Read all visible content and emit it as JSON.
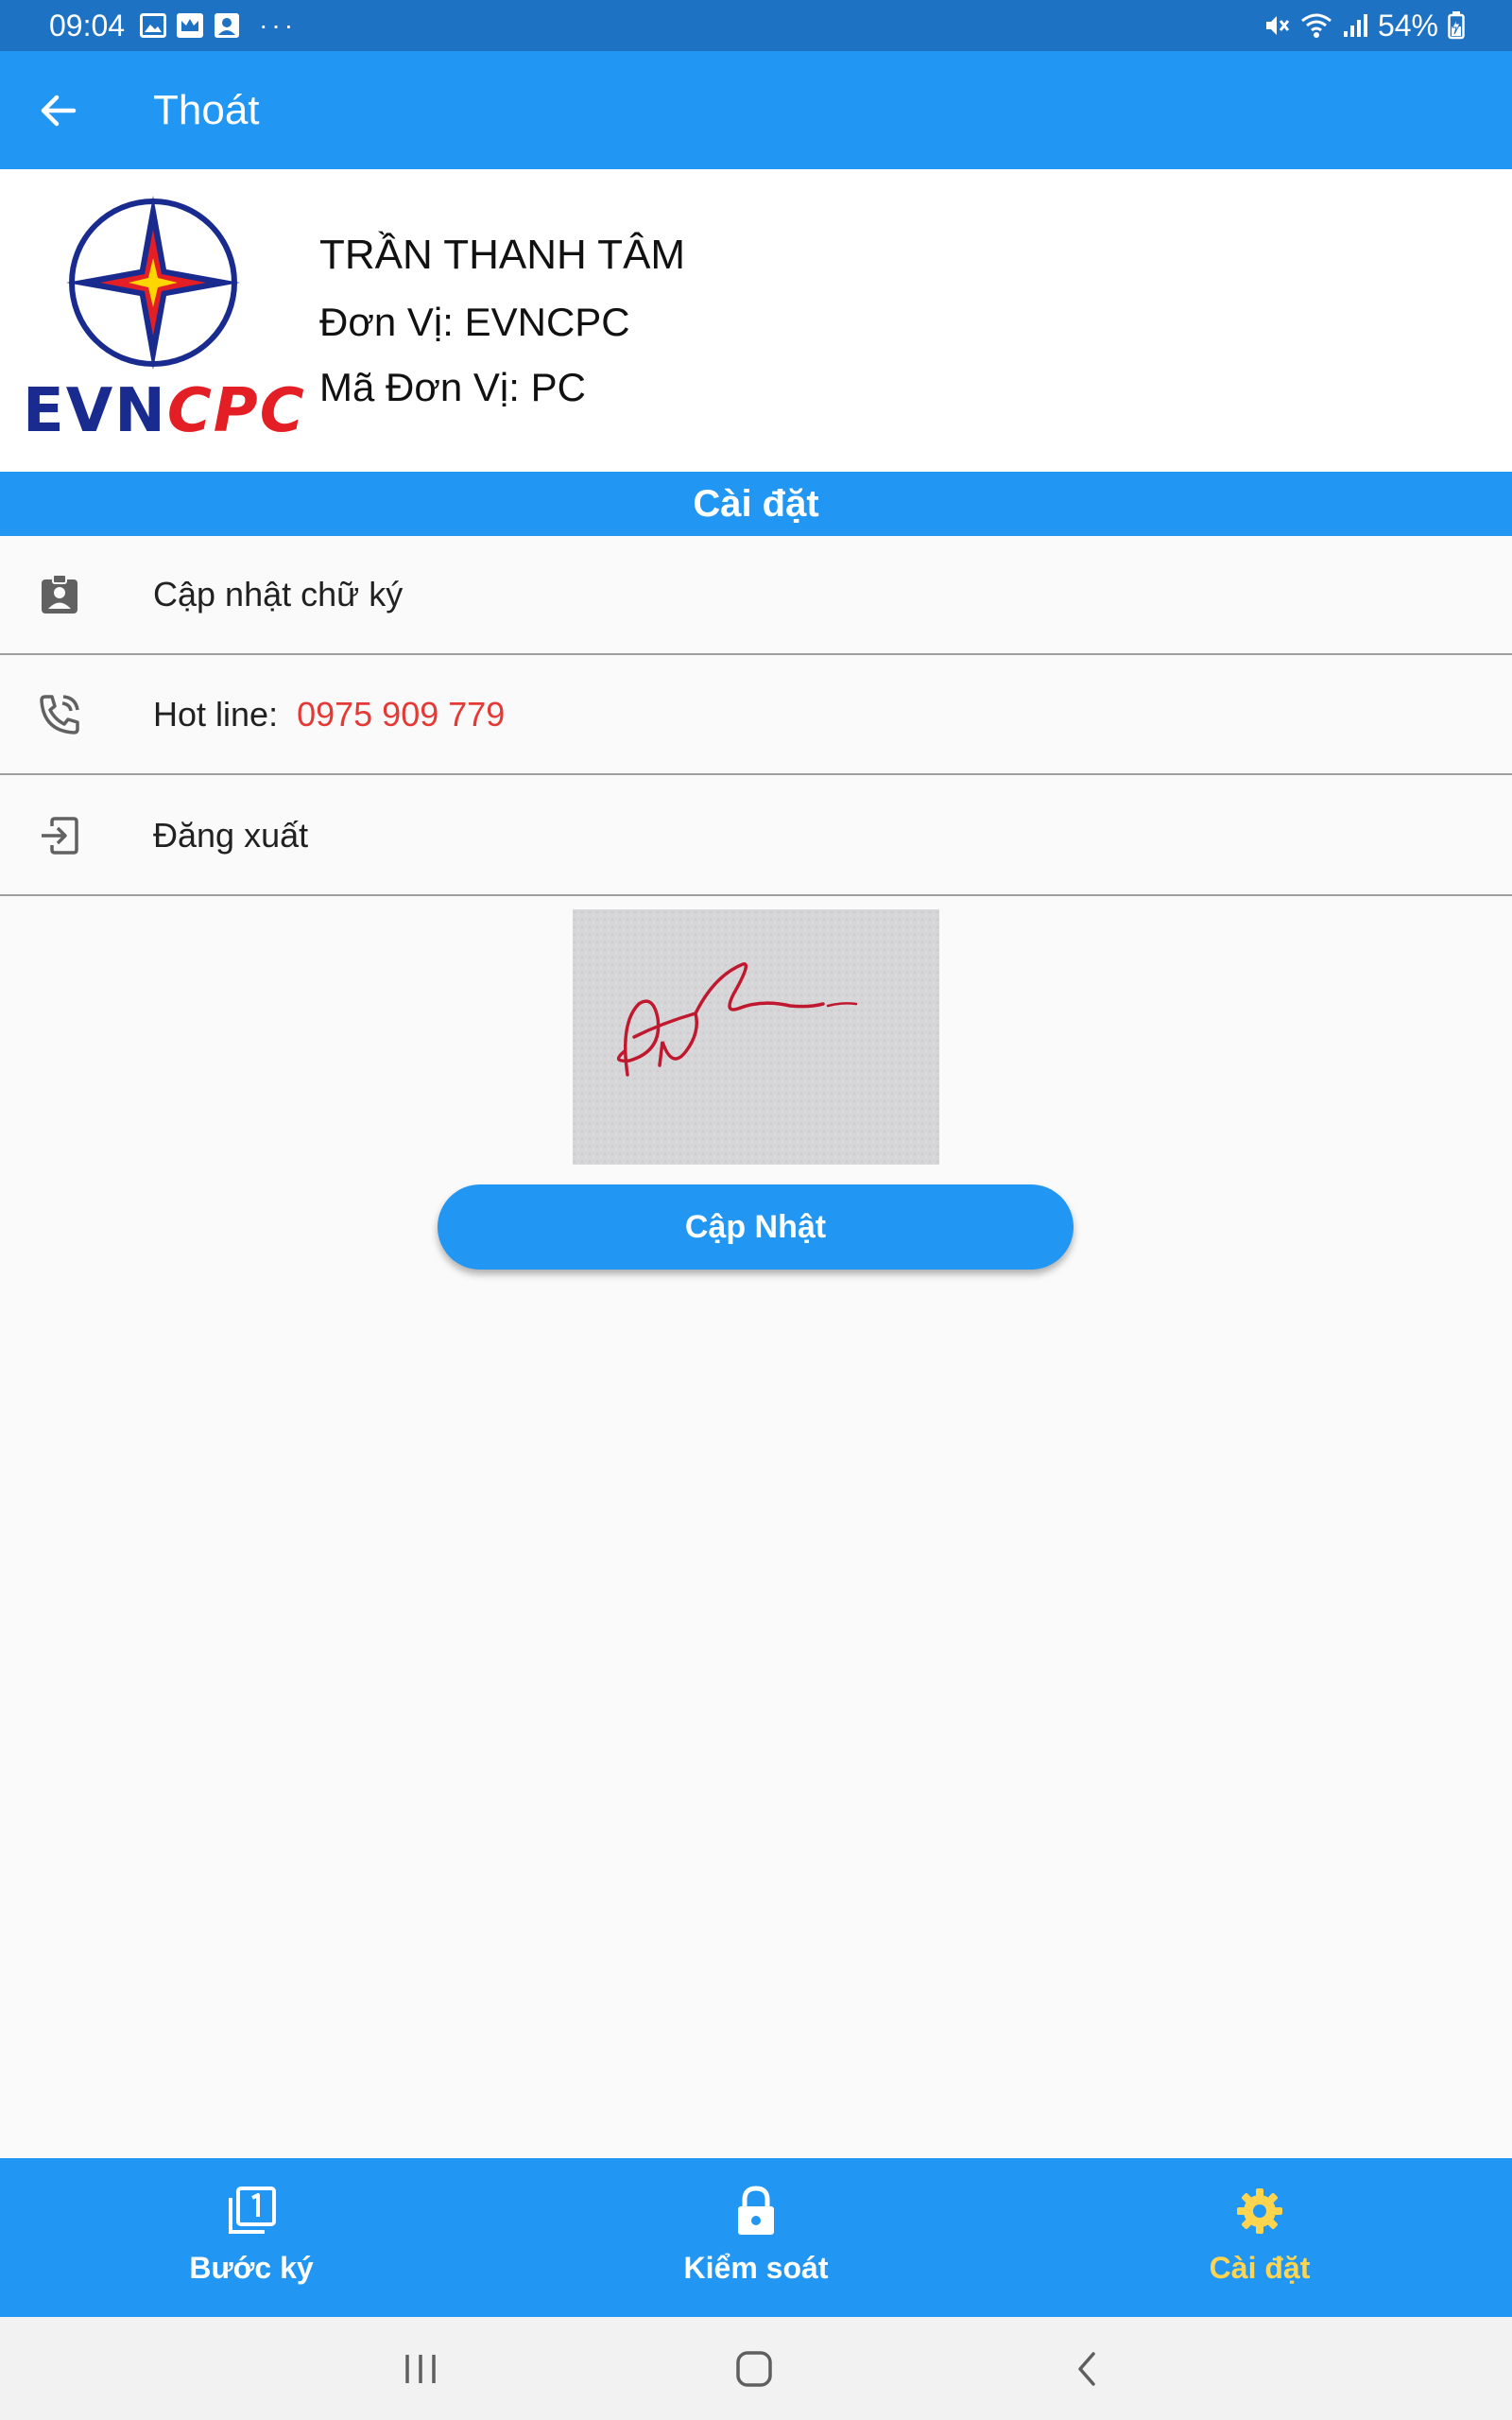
{
  "status_bar": {
    "time": "09:04",
    "battery": "54%",
    "icons": [
      "image-icon",
      "crown-icon",
      "contact-icon",
      "more-dots-icon",
      "mute-icon",
      "wifi-icon",
      "signal-icon",
      "battery-charging-icon"
    ]
  },
  "app_bar": {
    "title": "Thoát",
    "back_icon": "arrow-left-icon"
  },
  "profile": {
    "logo_text_evn": "EVN",
    "logo_text_cpc": "CPC",
    "name": "TRẦN THANH TÂM",
    "unit": "Đơn Vị: EVNCPC",
    "unit_code": "Mã Đơn Vị: PC"
  },
  "section": {
    "title": "Cài đặt"
  },
  "menu": {
    "items": [
      {
        "icon": "assignment-ind-icon",
        "label": "Cập nhật chữ ký"
      },
      {
        "icon": "phone-call-icon",
        "label": "Hot line:",
        "value": "0975 909 779"
      },
      {
        "icon": "logout-icon",
        "label": "Đăng xuất"
      }
    ]
  },
  "update_button": {
    "label": "Cập Nhật"
  },
  "bottom_nav": {
    "items": [
      {
        "icon": "filter-1-icon",
        "label": "Bước ký"
      },
      {
        "icon": "lock-icon",
        "label": "Kiểm soát"
      },
      {
        "icon": "gear-icon",
        "label": "Cài đặt",
        "active": true
      }
    ],
    "active_color": "#ffd54f"
  },
  "colors": {
    "primary": "#2196f3",
    "status_bar": "#1e72c4",
    "hotline": "#e53935",
    "background": "#fafafa"
  },
  "system_nav": {
    "icons": [
      "recent-apps-icon",
      "home-icon",
      "back-icon"
    ]
  }
}
